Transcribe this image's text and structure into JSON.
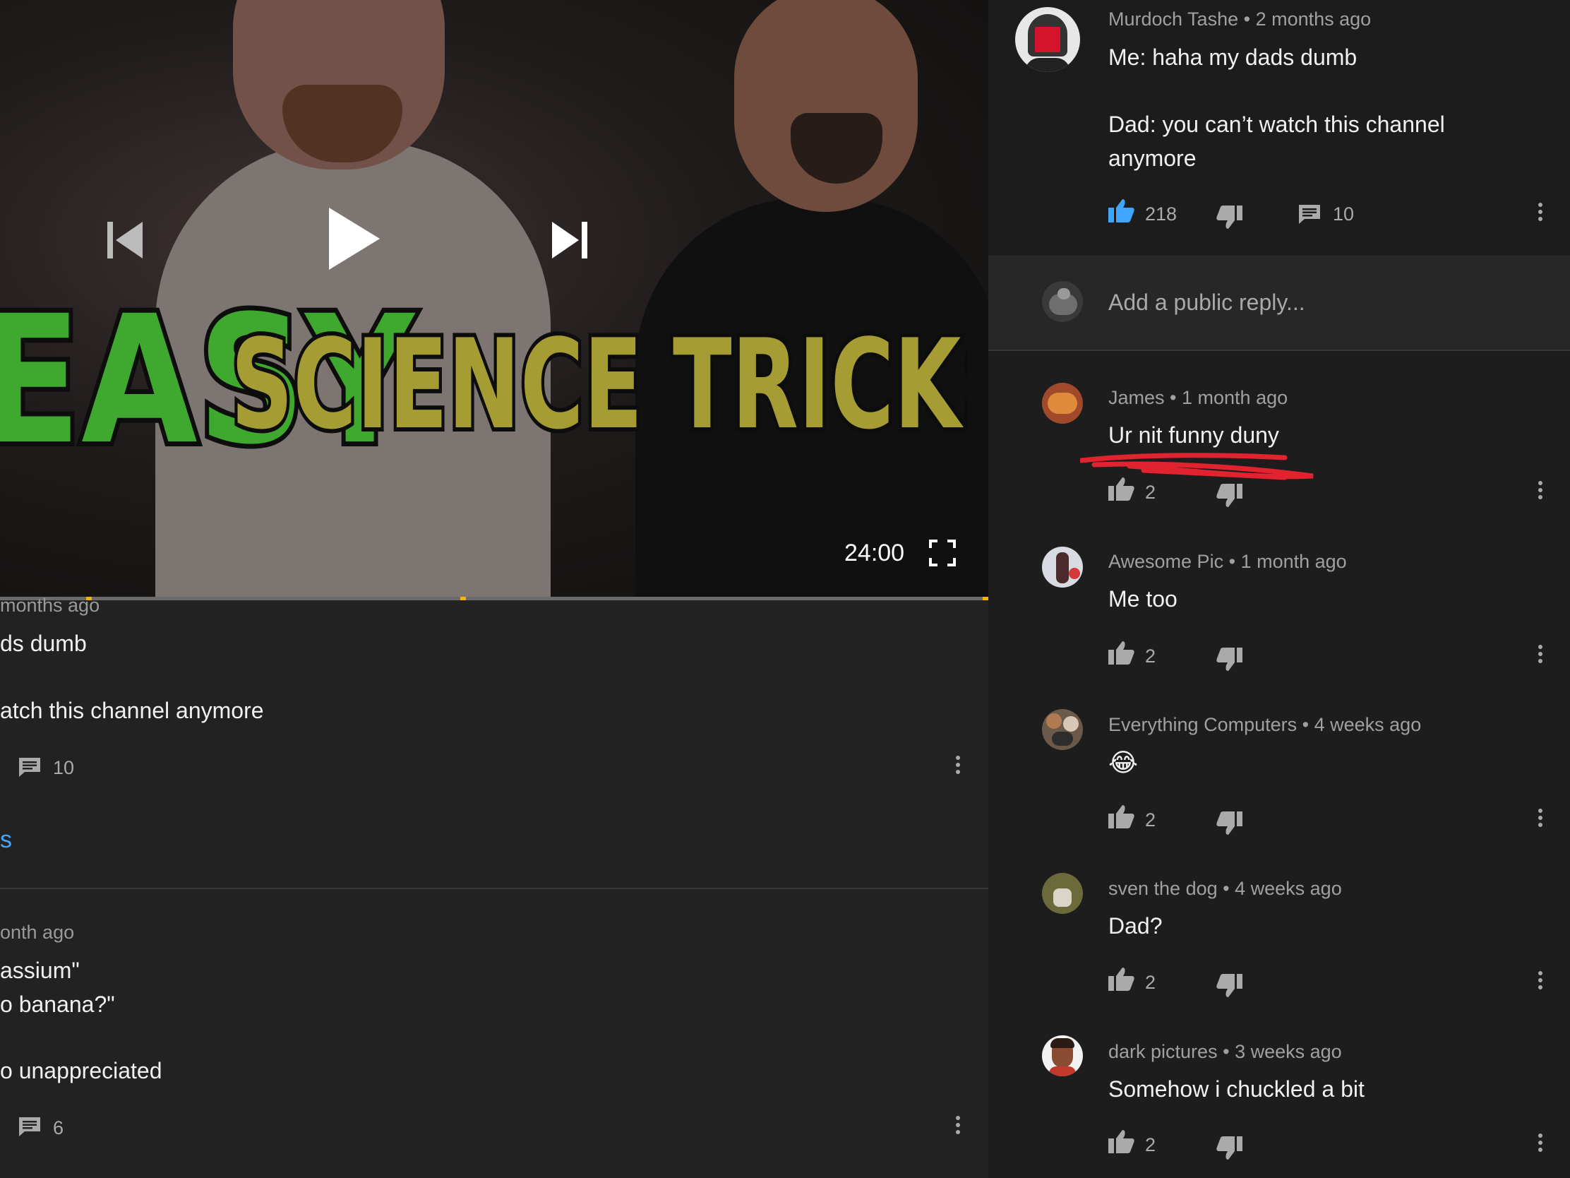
{
  "video": {
    "title_word_1": "EASY",
    "title_word_2": "SCIENCE TRICKS",
    "duration": "24:00",
    "controls": [
      "previous-icon",
      "play-icon",
      "next-icon",
      "fullscreen-icon"
    ]
  },
  "left_comments": {
    "comment1": {
      "meta": "months ago",
      "line1": "ds dumb",
      "line2": "atch this channel anymore",
      "reply_count": "10"
    },
    "link_fragment": "s",
    "comment2": {
      "meta": "onth ago",
      "line1": "assium\"",
      "line2": "o banana?\"",
      "line3": "o unappreciated",
      "reply_count": "6"
    }
  },
  "thread": {
    "parent": {
      "author": "Murdoch Tashe",
      "time": "2 months ago",
      "line1": "Me: haha my dads dumb",
      "line2": "Dad: you can’t watch this channel",
      "line3": "anymore",
      "likes": "218",
      "reply_count": "10"
    },
    "reply_placeholder": "Add a public reply...",
    "replies": [
      {
        "author": "James",
        "time": "1 month ago",
        "text": "Ur nit funny duny",
        "likes": "2"
      },
      {
        "author": "Awesome Pic",
        "time": "1 month ago",
        "text": "Me too",
        "likes": "2"
      },
      {
        "author": "Everything Computers",
        "time": "4 weeks ago",
        "text": "😂",
        "likes": "2"
      },
      {
        "author": "sven the dog",
        "time": "4 weeks ago",
        "text": "Dad?",
        "likes": "2"
      },
      {
        "author": "dark pictures",
        "time": "3 weeks ago",
        "text": "Somehow i chuckled a bit",
        "likes": "2"
      }
    ]
  },
  "colors": {
    "background": "#212121",
    "accent_blue": "#3ea6ff",
    "like_active": "#3ea6ff",
    "underline_scribble": "#e0232f",
    "title_green": "#3fa82e",
    "title_gold": "#a59c33"
  }
}
